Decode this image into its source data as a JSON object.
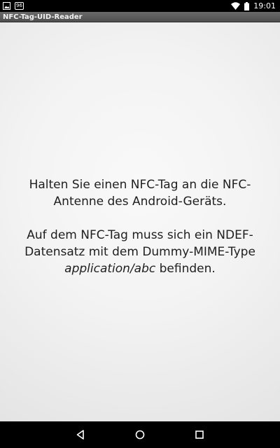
{
  "status_bar": {
    "left_icons": [
      "image-notification-icon",
      "android-96-icon"
    ],
    "badge_text": "96",
    "right_icons": [
      "wifi-icon",
      "battery-icon"
    ],
    "time": "19:01"
  },
  "app": {
    "title": "NFC-Tag-UID-Reader"
  },
  "message": {
    "line1": "Halten Sie einen NFC-Tag an die NFC-",
    "line2": "Antenne des Android-Geräts.",
    "line3": "Auf dem NFC-Tag muss sich ein NDEF-",
    "line4": "Datensatz mit dem Dummy-MIME-Type",
    "mime_type": "application/abc",
    "line5_suffix": " befinden."
  },
  "nav_bar": {
    "buttons": [
      "back-icon",
      "home-icon",
      "recent-apps-icon"
    ]
  },
  "colors": {
    "status_bar_bg": "#000000",
    "title_bar_bg": "#5c5c5c",
    "content_bg": "#f3f3f3",
    "text": "#1e1e1e",
    "nav_bar_bg": "#000000"
  }
}
